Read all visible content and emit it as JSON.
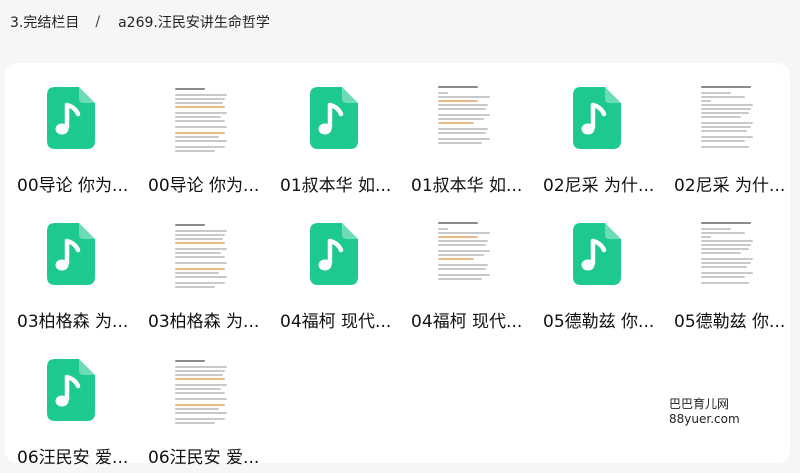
{
  "breadcrumb": {
    "parent": "3.完结栏目",
    "separator": "/",
    "current": "a269.汪民安讲生命哲学"
  },
  "colors": {
    "audio_icon": "#1ec98f",
    "doc_accent": "#f0b98a"
  },
  "files": [
    {
      "name": "00导论 你为...",
      "type": "audio",
      "icon": "music-file-icon"
    },
    {
      "name": "00导论 你为...",
      "type": "doc",
      "icon": "document-thumbnail"
    },
    {
      "name": "01叔本华 如...",
      "type": "audio",
      "icon": "music-file-icon"
    },
    {
      "name": "01叔本华 如...",
      "type": "doc",
      "icon": "document-thumbnail"
    },
    {
      "name": "02尼采 为什...",
      "type": "audio",
      "icon": "music-file-icon"
    },
    {
      "name": "02尼采 为什...",
      "type": "doc",
      "icon": "document-thumbnail"
    },
    {
      "name": "03柏格森 为...",
      "type": "audio",
      "icon": "music-file-icon"
    },
    {
      "name": "03柏格森 为...",
      "type": "doc",
      "icon": "document-thumbnail"
    },
    {
      "name": "04福柯 现代...",
      "type": "audio",
      "icon": "music-file-icon"
    },
    {
      "name": "04福柯 现代...",
      "type": "doc",
      "icon": "document-thumbnail"
    },
    {
      "name": "05德勒兹 你...",
      "type": "audio",
      "icon": "music-file-icon"
    },
    {
      "name": "05德勒兹 你...",
      "type": "doc",
      "icon": "document-thumbnail"
    },
    {
      "name": "06汪民安 爱...",
      "type": "audio",
      "icon": "music-file-icon"
    },
    {
      "name": "06汪民安 爱...",
      "type": "doc",
      "icon": "document-thumbnail"
    }
  ],
  "watermark": "巴巴育儿网 88yuer.com"
}
